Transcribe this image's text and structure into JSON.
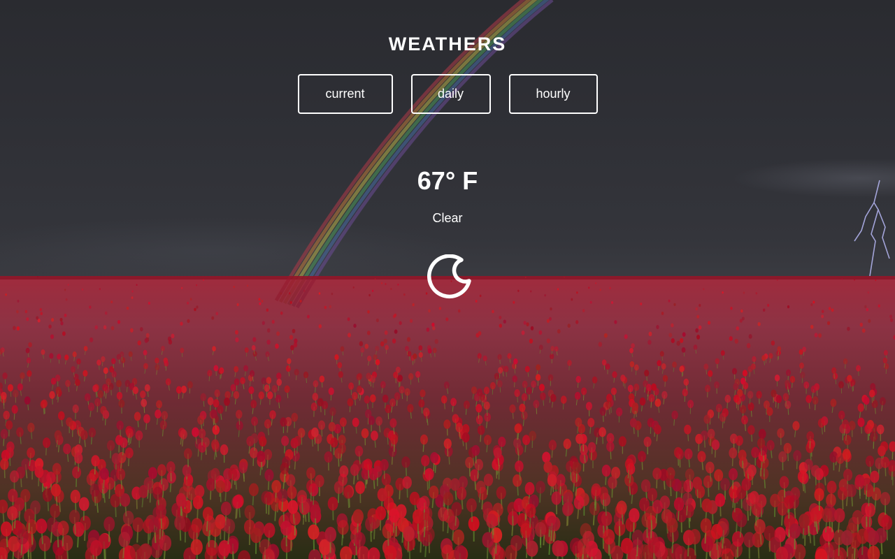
{
  "app": {
    "title": "WEATHERS"
  },
  "tabs": [
    {
      "label": "current"
    },
    {
      "label": "daily"
    },
    {
      "label": "hourly"
    }
  ],
  "weather": {
    "temperature": "67° F",
    "summary": "Clear",
    "icon": "clear-night-moon-icon"
  },
  "colors": {
    "text": "#ffffff",
    "sky": "#2e2f35",
    "field": "#8c1428"
  }
}
